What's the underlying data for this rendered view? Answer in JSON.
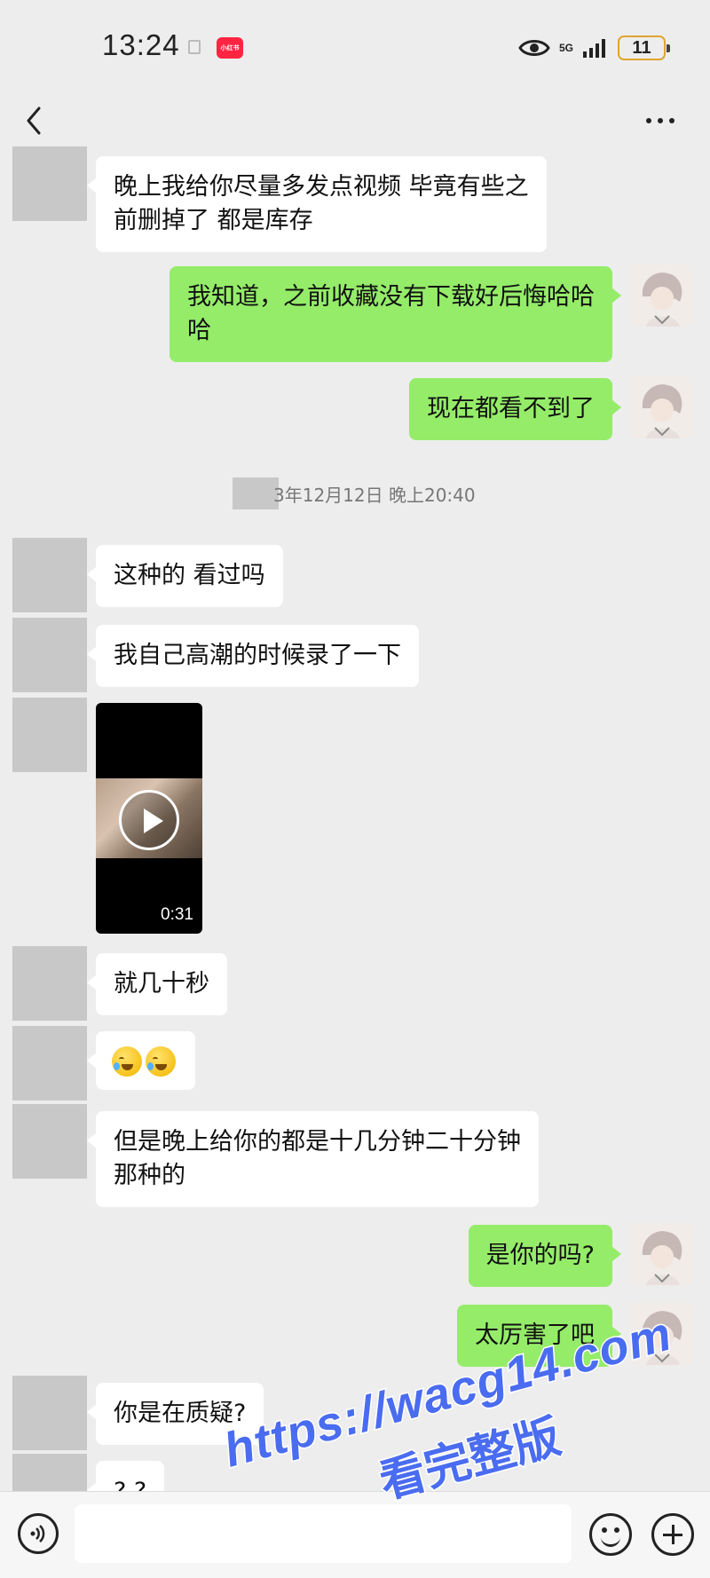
{
  "status_bar": {
    "time": "13:24",
    "app_badge": "小红书",
    "network": "5G",
    "battery": "11"
  },
  "messages": [
    {
      "side": "in",
      "text": "晚上我给你尽量多发点视频 毕竟有些之\n前删掉了 都是库存"
    },
    {
      "side": "out",
      "text": "我知道，之前收藏没有下载好后悔哈哈\n哈"
    },
    {
      "side": "out",
      "text": "现在都看不到了"
    },
    {
      "side": "in",
      "text": "这种的 看过吗"
    },
    {
      "side": "in",
      "text": "我自己高潮的时候录了一下"
    },
    {
      "side": "in",
      "type": "video",
      "duration": "0:31"
    },
    {
      "side": "in",
      "text": "就几十秒"
    },
    {
      "side": "in",
      "type": "emoji",
      "emoji": "face-with-tears-of-joy x2"
    },
    {
      "side": "in",
      "text": "但是晚上给你的都是十几分钟二十分钟\n那种的"
    },
    {
      "side": "out",
      "text": "是你的吗?"
    },
    {
      "side": "out",
      "text": "太厉害了吧"
    },
    {
      "side": "in",
      "text": "你是在质疑?"
    },
    {
      "side": "in",
      "text": "? ?"
    }
  ],
  "timestamp": "3年12月12日 晚上20:40",
  "watermark": {
    "url": "https://wacg14.com",
    "subtitle": "看完整版"
  },
  "input": {
    "placeholder": ""
  },
  "colors": {
    "background": "#ededed",
    "incoming_bubble": "#ffffff",
    "outgoing_bubble": "#95ec69",
    "watermark": "#4a6cf0"
  }
}
